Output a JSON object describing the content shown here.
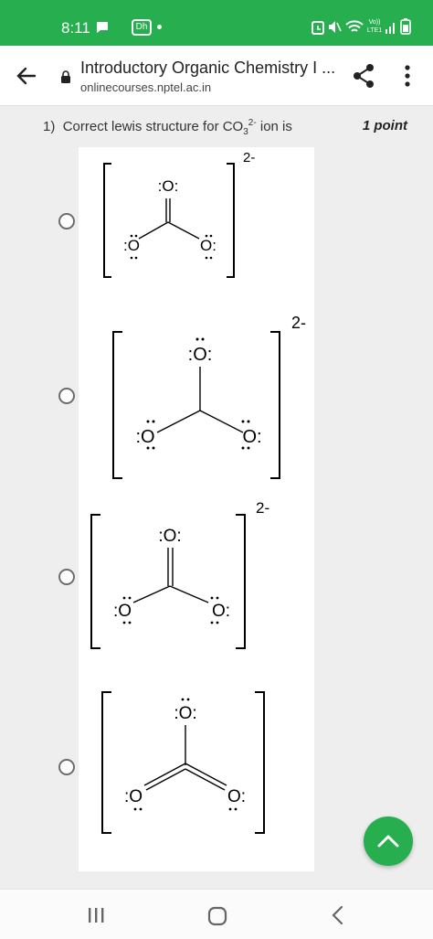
{
  "status_bar": {
    "time": "8:11",
    "icons": [
      "chat-icon",
      "app-badge-icon",
      "dot-icon",
      "alarm-icon",
      "mute-icon",
      "wifi-icon",
      "volte-icon",
      "signal-icon",
      "battery-icon"
    ],
    "volte_text_top": "Vo))",
    "volte_text_bottom": "LTE1",
    "app_badge_text": "Dh",
    "background_color": "#27ae4f"
  },
  "app_bar": {
    "title": "Introductory Organic Chemistry I ...",
    "url": "onlinecourses.nptel.ac.in"
  },
  "question": {
    "number": "1)",
    "text_before": "Correct lewis structure for CO",
    "subscript": "3",
    "superscript": "2-",
    "text_after": " ion is",
    "points": "1 point"
  },
  "options": [
    {
      "charge": "2-",
      "top_atom": ":O:",
      "left_atom": ":O",
      "right_atom": "O:",
      "atom_letter": "O",
      "bonds": "double-top"
    },
    {
      "charge": "2-",
      "top_atom": ":O:",
      "left_atom": ":O",
      "right_atom": "O:",
      "atom_letter": "O",
      "bonds": "all-single"
    },
    {
      "charge": "2-",
      "top_atom": ":O:",
      "left_atom": ":O",
      "right_atom": "O:",
      "atom_letter": "O",
      "bonds": "double-top"
    },
    {
      "charge": "",
      "top_atom": ":O:",
      "left_atom": ":O",
      "right_atom": "O:",
      "atom_letter": "O",
      "bonds": "double-sides"
    }
  ],
  "colors": {
    "accent": "#27ae4f",
    "radio_border": "#6d6d6d"
  },
  "fab": {
    "icon": "chevron-up-icon"
  },
  "nav_bar": {
    "icons": [
      "recent-apps-icon",
      "home-icon",
      "back-nav-icon"
    ]
  }
}
